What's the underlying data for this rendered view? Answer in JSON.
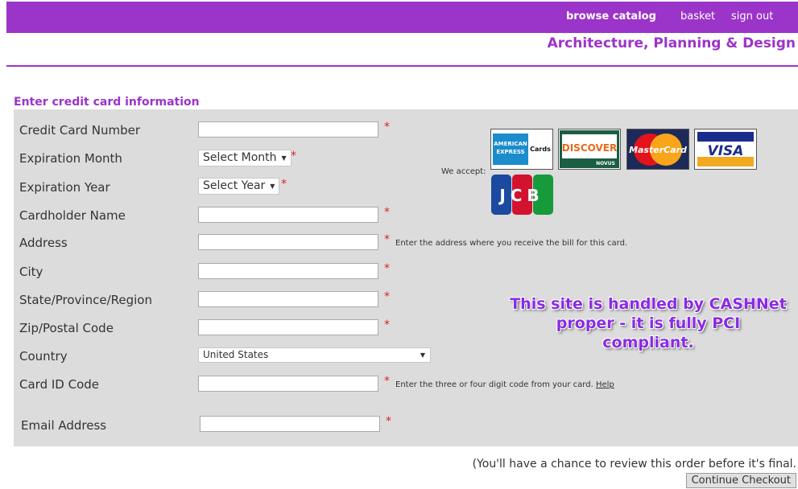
{
  "nav": {
    "browse_catalog": "browse catalog",
    "basket": "basket",
    "sign_out": "sign out"
  },
  "department": "Architecture, Planning & Design",
  "form": {
    "title": "Enter credit card information",
    "labels": {
      "card_number": "Credit Card Number",
      "exp_month": "Expiration Month",
      "exp_year": "Expiration Year",
      "cardholder": "Cardholder Name",
      "address": "Address",
      "city": "City",
      "state": "State/Province/Region",
      "zip": "Zip/Postal Code",
      "country": "Country",
      "card_id": "Card ID Code",
      "email": "Email Address"
    },
    "exp_month_selected": "Select Month",
    "exp_year_selected": "Select Year",
    "country_selected": "United States",
    "required_mark": "*",
    "address_note": "Enter the address where you receive the bill for this card.",
    "card_id_note": "Enter the three or four digit code from your card.",
    "help_link": "Help",
    "we_accept": "We accept:"
  },
  "cards": {
    "amex": {
      "line1": "AMERICAN",
      "line2": "EXPRESS",
      "tag": "Cards"
    },
    "discover": {
      "name": "DISCOVER",
      "sub": "NOVUS"
    },
    "mastercard": "MasterCard",
    "visa": "VISA",
    "jcb": "JCB"
  },
  "pci_note": "This site is handled by CASHNet proper - it is fully PCI compliant.",
  "review_note": "(You'll have a chance to review this order before it's final.",
  "continue_label": "Continue Checkout",
  "colors": {
    "accent": "#9b34c9",
    "panel": "#dcdcdc",
    "required": "#e02020"
  }
}
